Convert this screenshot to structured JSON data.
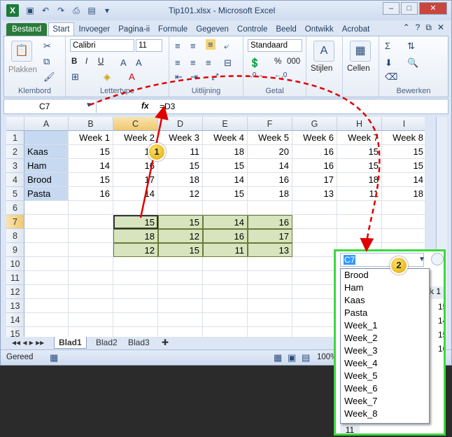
{
  "window": {
    "title": "Tip101.xlsx - Microsoft Excel",
    "app_icon": "X"
  },
  "ribbon_tabs": [
    "Bestand",
    "Start",
    "Invoeger",
    "Pagina-ii",
    "Formule",
    "Gegeven",
    "Controle",
    "Beeld",
    "Ontwikk",
    "Acrobat"
  ],
  "ribbon": {
    "clipboard": {
      "paste": "Plakken",
      "label": "Klembord"
    },
    "font": {
      "name": "Calibri",
      "size": "11",
      "label": "Lettertype"
    },
    "alignment": {
      "label": "Uitlijning"
    },
    "number": {
      "format": "Standaard",
      "percent": "%",
      "thousands": "000",
      "label": "Getal"
    },
    "styles": {
      "label": "Stijlen"
    },
    "cells": {
      "label": "Cellen"
    },
    "editing": {
      "label": "Bewerken"
    }
  },
  "formula_bar": {
    "name_box": "C7",
    "fx": "fx",
    "formula": "=D3"
  },
  "columns": [
    "A",
    "B",
    "C",
    "D",
    "E",
    "F",
    "G",
    "H",
    "I"
  ],
  "rows": [
    "1",
    "2",
    "3",
    "4",
    "5",
    "6",
    "7",
    "8",
    "9",
    "10",
    "11",
    "12",
    "13",
    "14",
    "15"
  ],
  "header_row": [
    "Week 1",
    "Week 2",
    "Week 3",
    "Week 4",
    "Week 5",
    "Week 6",
    "Week 7",
    "Week 8"
  ],
  "data_rows": [
    {
      "label": "Kaas",
      "values": [
        "15",
        "15",
        "11",
        "18",
        "20",
        "16",
        "15",
        "15"
      ]
    },
    {
      "label": "Ham",
      "values": [
        "14",
        "16",
        "15",
        "15",
        "14",
        "16",
        "15",
        "15"
      ]
    },
    {
      "label": "Brood",
      "values": [
        "15",
        "17",
        "18",
        "14",
        "16",
        "17",
        "18",
        "14"
      ]
    },
    {
      "label": "Pasta",
      "values": [
        "16",
        "14",
        "12",
        "15",
        "18",
        "13",
        "11",
        "18"
      ]
    }
  ],
  "green_block": [
    [
      "15",
      "15",
      "14",
      "16"
    ],
    [
      "18",
      "12",
      "16",
      "17"
    ],
    [
      "12",
      "15",
      "11",
      "13"
    ]
  ],
  "sheet_tabs": [
    "Blad1",
    "Blad2",
    "Blad3"
  ],
  "status": {
    "ready": "Gereed",
    "zoom": "100%"
  },
  "zoom_panel": {
    "name_box": "C7",
    "dropdown": [
      "Brood",
      "Ham",
      "Kaas",
      "Pasta",
      "Week_1",
      "Week_2",
      "Week_3",
      "Week_4",
      "Week_5",
      "Week_6",
      "Week_7",
      "Week_8"
    ],
    "bg_col_header": "k 1",
    "bg_values": [
      "15",
      "14",
      "15",
      "16"
    ],
    "bg_row": "11"
  },
  "callouts": [
    "1",
    "2"
  ]
}
